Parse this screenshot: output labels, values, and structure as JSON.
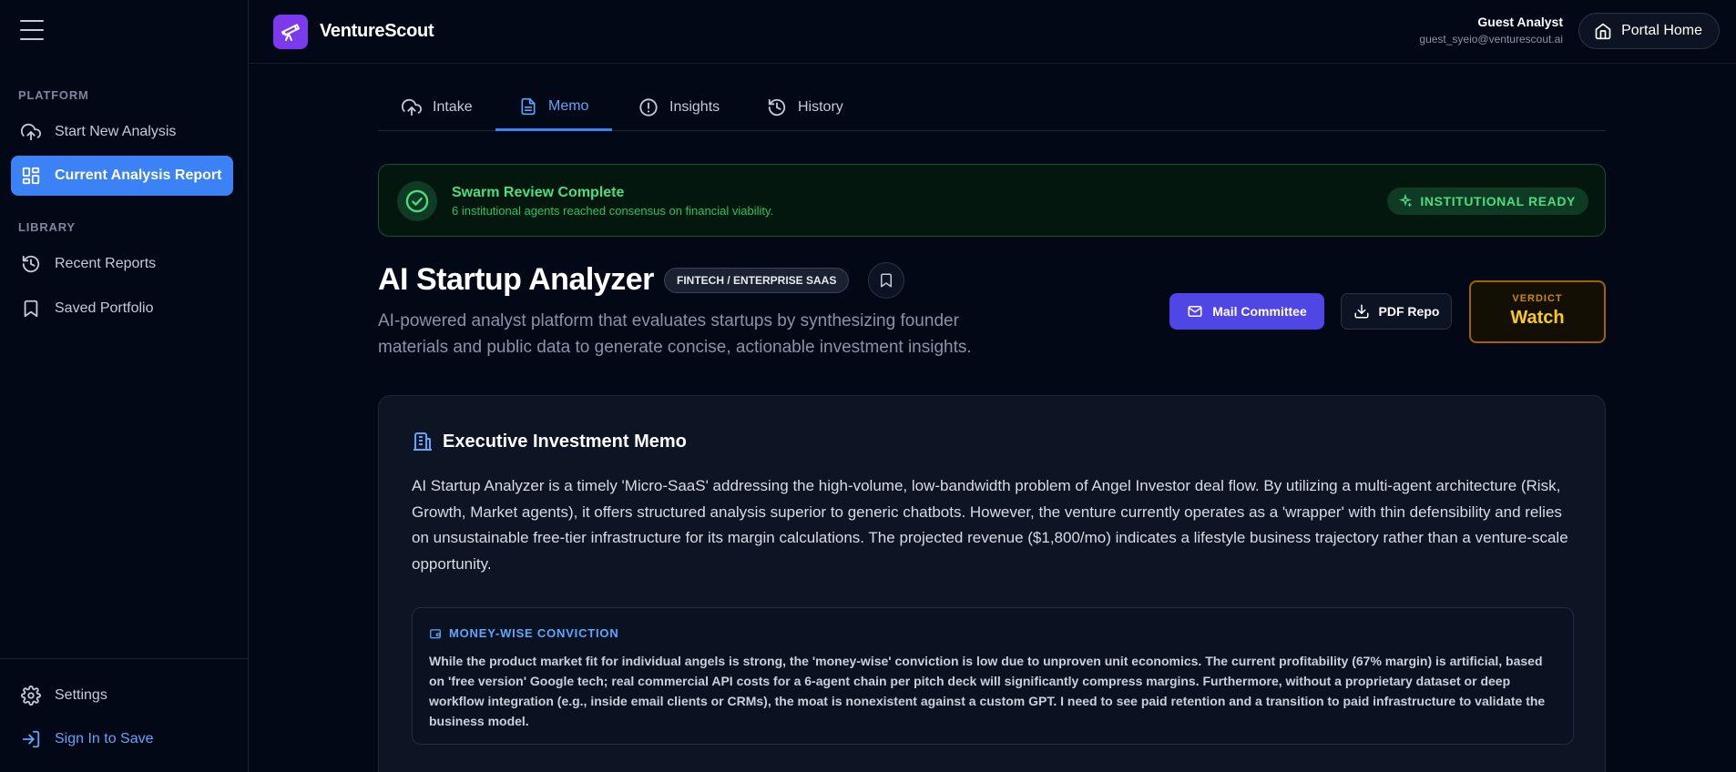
{
  "app": {
    "brand": "VentureScout"
  },
  "sidebar": {
    "section_platform": "PLATFORM",
    "section_library": "LIBRARY",
    "items": [
      {
        "label": "Start New Analysis",
        "icon": "cloud-upload-icon"
      },
      {
        "label": "Current Analysis Report",
        "icon": "dashboard-grid-icon"
      },
      {
        "label": "Recent Reports",
        "icon": "history-icon"
      },
      {
        "label": "Saved Portfolio",
        "icon": "bookmark-icon"
      }
    ],
    "settings_label": "Settings",
    "signin_label": "Sign In to Save"
  },
  "header": {
    "user_name": "Guest Analyst",
    "user_email": "guest_syeio@venturescout.ai",
    "portal_label": "Portal Home"
  },
  "tabs": [
    {
      "label": "Intake",
      "icon": "cloud-upload-icon"
    },
    {
      "label": "Memo",
      "icon": "document-icon",
      "active": true
    },
    {
      "label": "Insights",
      "icon": "alert-circle-icon"
    },
    {
      "label": "History",
      "icon": "history-icon"
    }
  ],
  "banner": {
    "title": "Swarm Review Complete",
    "subtitle": "6 institutional agents reached consensus on financial viability.",
    "badge": "INSTITUTIONAL READY"
  },
  "report": {
    "title": "AI Startup Analyzer",
    "tag": "FINTECH / ENTERPRISE SAAS",
    "subtitle": "AI-powered analyst platform that evaluates startups by synthesizing founder materials and public data to generate concise, actionable investment insights.",
    "mail_label": "Mail Committee",
    "pdf_label": "PDF Repo",
    "verdict_label": "VERDICT",
    "verdict_value": "Watch"
  },
  "memo": {
    "title": "Executive Investment Memo",
    "body": "AI Startup Analyzer is a timely 'Micro-SaaS' addressing the high-volume, low-bandwidth problem of Angel Investor deal flow. By utilizing a multi-agent architecture (Risk, Growth, Market agents), it offers structured analysis superior to generic chatbots. However, the venture currently operates as a 'wrapper' with thin defensibility and relies on unsustainable free-tier infrastructure for its margin calculations. The projected revenue ($1,800/mo) indicates a lifestyle business trajectory rather than a venture-scale opportunity.",
    "conviction_title": "MONEY-WISE CONVICTION",
    "conviction_body": "While the product market fit for individual angels is strong, the 'money-wise' conviction is low due to unproven unit economics. The current profitability (67% margin) is artificial, based on 'free version' Google tech; real commercial API costs for a 6-agent chain per pitch deck will significantly compress margins. Furthermore, without a proprietary dataset or deep workflow integration (e.g., inside email clients or CRMs), the moat is nonexistent against a custom GPT. I need to see paid retention and a transition to paid infrastructure to validate the business model."
  },
  "colors": {
    "accent": "#3b82f6",
    "brand": "#7c3aed",
    "success": "#4ade80",
    "verdict": "#facc15",
    "mail_button": "#4f46e5"
  }
}
